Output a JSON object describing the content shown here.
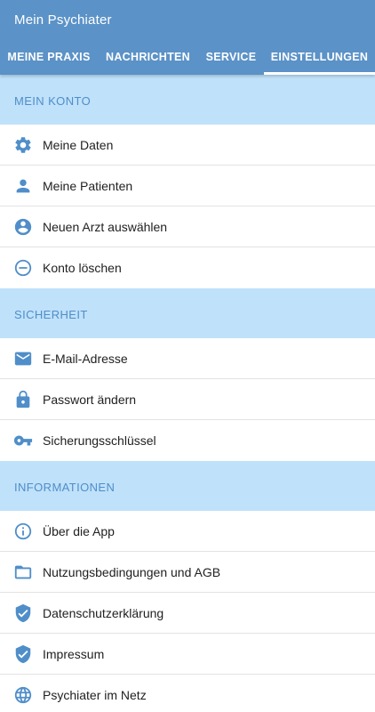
{
  "app": {
    "title": "Mein Psychiater",
    "accent_color": "#5b92c7",
    "section_bg_color": "#bfe1fa",
    "icon_color": "#4f8ec9"
  },
  "tabs": [
    {
      "label": "MEINE PRAXIS",
      "active": false
    },
    {
      "label": "NACHRICHTEN",
      "active": false
    },
    {
      "label": "SERVICE",
      "active": false
    },
    {
      "label": "EINSTELLUNGEN",
      "active": true
    }
  ],
  "sections": [
    {
      "title": "MEIN KONTO",
      "items": [
        {
          "label": "Meine Daten",
          "icon": "gear-icon"
        },
        {
          "label": "Meine Patienten",
          "icon": "person-icon"
        },
        {
          "label": "Neuen Arzt auswählen",
          "icon": "account-circle-icon"
        },
        {
          "label": "Konto löschen",
          "icon": "remove-circle-icon"
        }
      ]
    },
    {
      "title": "SICHERHEIT",
      "items": [
        {
          "label": "E-Mail-Adresse",
          "icon": "mail-icon"
        },
        {
          "label": "Passwort ändern",
          "icon": "lock-icon"
        },
        {
          "label": "Sicherungsschlüssel",
          "icon": "key-icon"
        }
      ]
    },
    {
      "title": "INFORMATIONEN",
      "items": [
        {
          "label": "Über die App",
          "icon": "info-icon"
        },
        {
          "label": "Nutzungsbedingungen und AGB",
          "icon": "folder-icon"
        },
        {
          "label": "Datenschutzerklärung",
          "icon": "shield-check-icon"
        },
        {
          "label": "Impressum",
          "icon": "shield-check-icon"
        },
        {
          "label": "Psychiater im Netz",
          "icon": "globe-icon"
        }
      ]
    }
  ]
}
